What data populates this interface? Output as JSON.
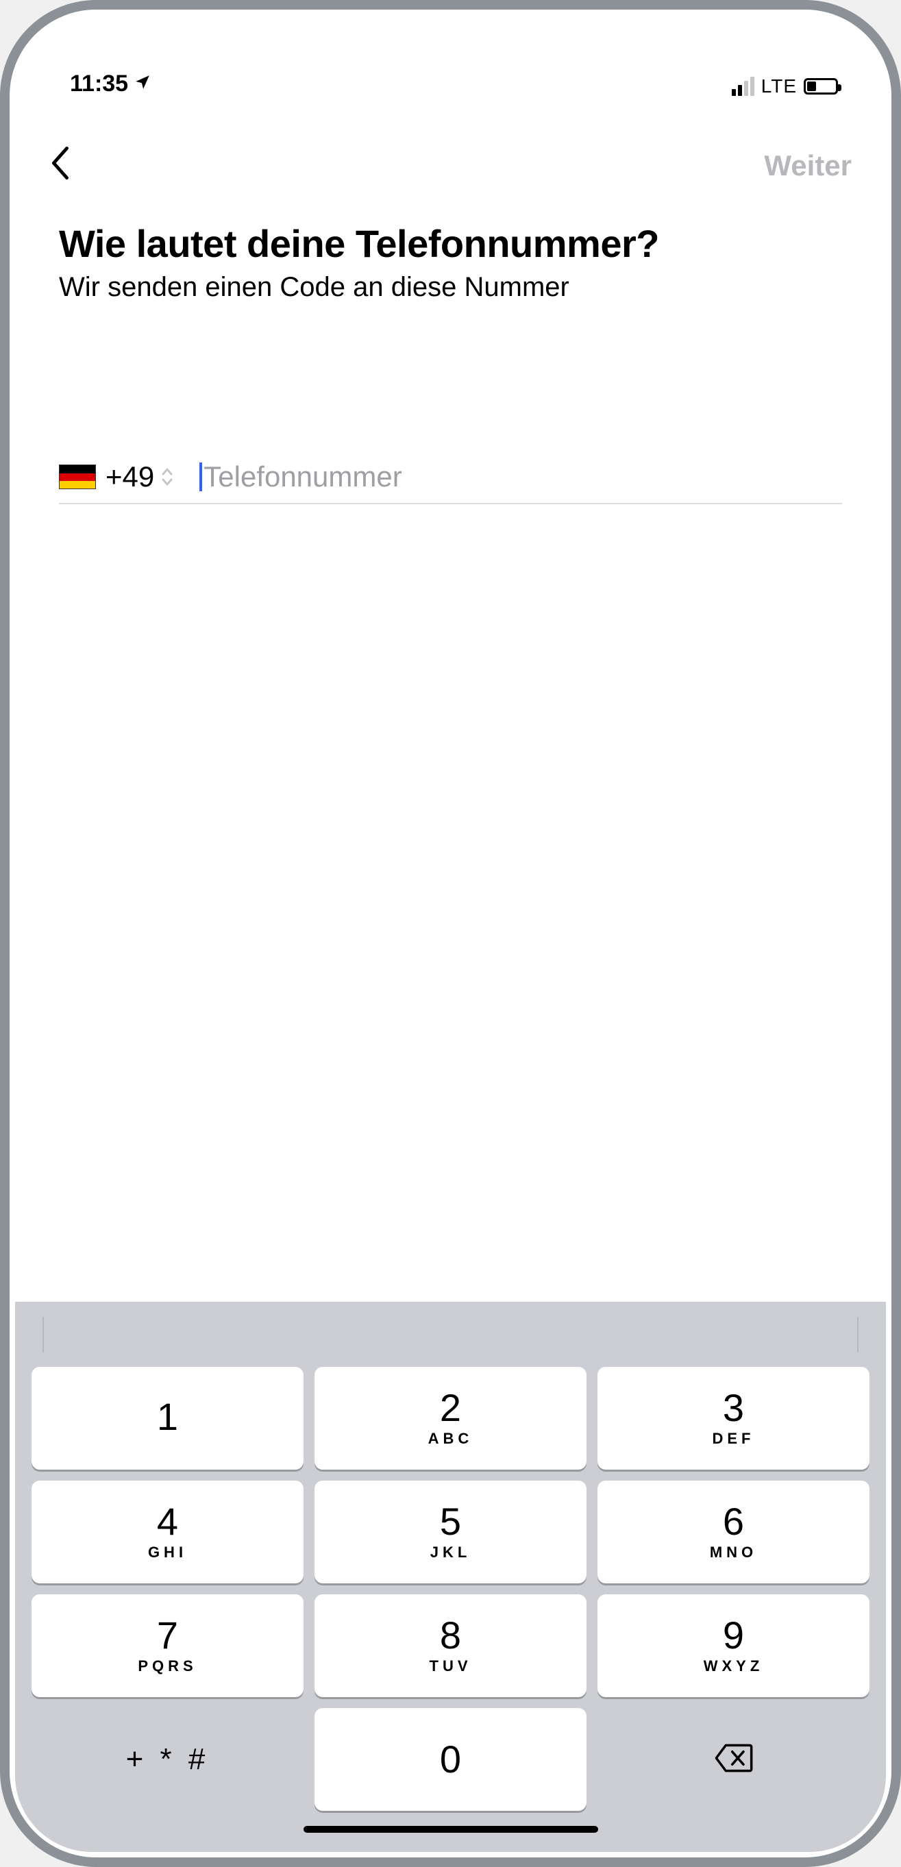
{
  "status": {
    "time": "11:35",
    "network_label": "LTE"
  },
  "nav": {
    "next_label": "Weiter"
  },
  "content": {
    "title": "Wie lautet deine Telefonnummer?",
    "subtitle": "Wir senden einen Code an diese Nummer",
    "dial_code": "+49",
    "placeholder": "Telefonnummer",
    "value": ""
  },
  "keyboard": {
    "keys": [
      {
        "digit": "1",
        "letters": ""
      },
      {
        "digit": "2",
        "letters": "ABC"
      },
      {
        "digit": "3",
        "letters": "DEF"
      },
      {
        "digit": "4",
        "letters": "GHI"
      },
      {
        "digit": "5",
        "letters": "JKL"
      },
      {
        "digit": "6",
        "letters": "MNO"
      },
      {
        "digit": "7",
        "letters": "PQRS"
      },
      {
        "digit": "8",
        "letters": "TUV"
      },
      {
        "digit": "9",
        "letters": "WXYZ"
      }
    ],
    "symbols_label": "+ * #",
    "zero": "0"
  }
}
